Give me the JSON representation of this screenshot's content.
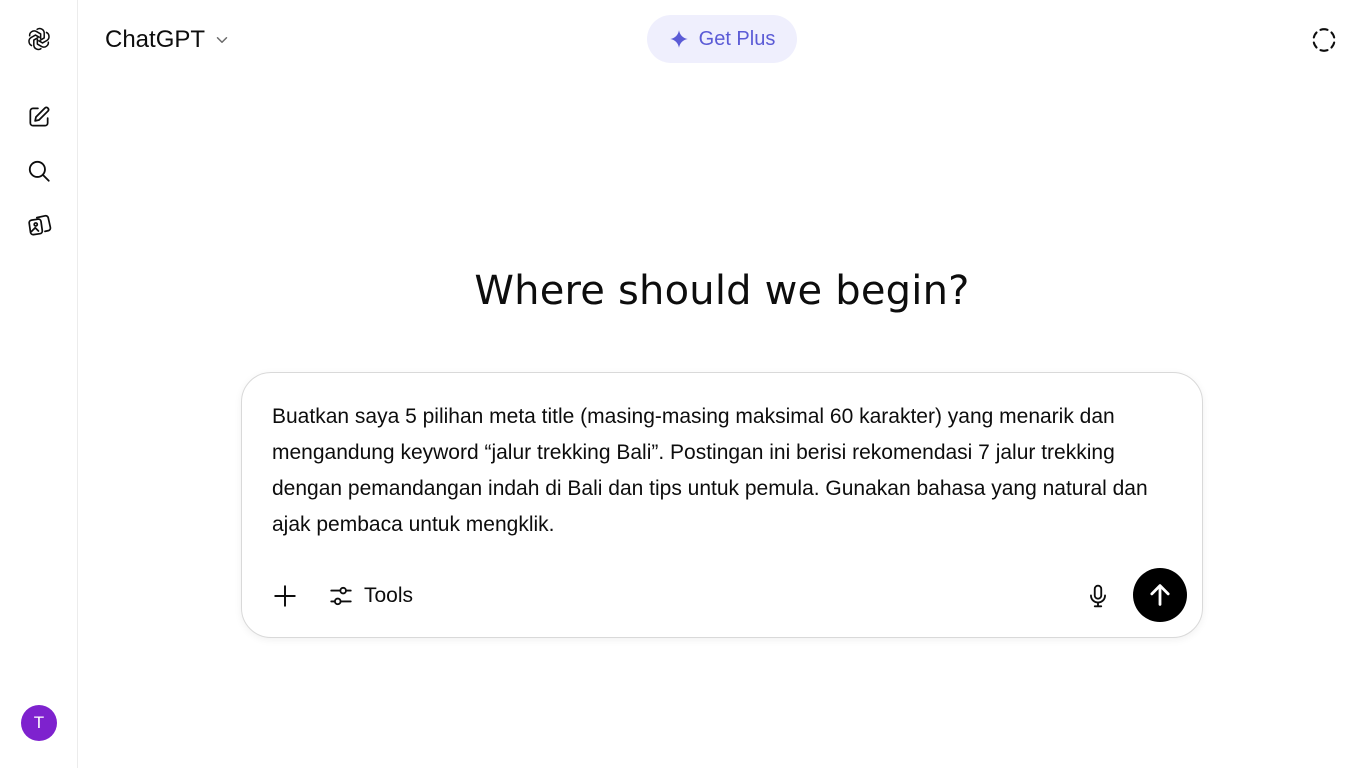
{
  "colors": {
    "accent": "#5b5bd6",
    "accent_bg": "#efeffd",
    "send_bg": "#000000",
    "avatar_bg": "#7e22ce"
  },
  "sidebar": {
    "items": [
      {
        "icon": "openai-logo-icon"
      },
      {
        "icon": "new-chat-icon"
      },
      {
        "icon": "search-icon"
      },
      {
        "icon": "library-icon"
      }
    ],
    "avatar_initial": "T"
  },
  "header": {
    "model_name": "ChatGPT",
    "get_plus_label": "Get Plus",
    "temporary_chat_icon": "dashed-circle-icon"
  },
  "main": {
    "heading": "Where should we begin?"
  },
  "composer": {
    "prompt": "Buatkan saya 5 pilihan meta title (masing-masing maksimal 60 karakter) yang menarik dan mengandung keyword “jalur trekking Bali”. Postingan ini berisi rekomendasi 7 jalur trekking dengan pemandangan indah di Bali dan tips untuk pemula. Gunakan bahasa yang natural dan ajak pembaca untuk mengklik.",
    "tools_label": "Tools"
  }
}
